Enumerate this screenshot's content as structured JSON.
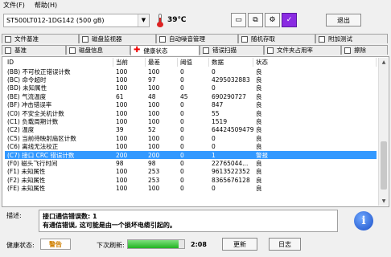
{
  "menu": {
    "file": "文件(F)",
    "help": "帮助(H)"
  },
  "toolbar": {
    "disk": "ST500LT012-1DG142 (500 gB)",
    "temperature": "39℃",
    "exit_label": "退出",
    "icons": [
      "window-icon",
      "copy-icon",
      "settings-icon",
      "check-icon"
    ]
  },
  "tabs_row1": [
    "文件基准",
    "磁盘监视器",
    "自动噪音管理",
    "随机存取",
    "附加测试"
  ],
  "tabs_row2": [
    "基准",
    "磁盘信息",
    "健康状态",
    "错误扫描",
    "文件夹占用率",
    "擦除"
  ],
  "active_tab": "健康状态",
  "table": {
    "headers": [
      "ID",
      "当前",
      "最差",
      "阈值",
      "数据",
      "状态"
    ],
    "rows": [
      [
        "(BB) 不可校正错误计数",
        "100",
        "100",
        "0",
        "0",
        "良"
      ],
      [
        "(BC) 命令超时",
        "100",
        "97",
        "0",
        "4295032883",
        "良"
      ],
      [
        "(BD) 未知属性",
        "100",
        "100",
        "0",
        "0",
        "良"
      ],
      [
        "(BE) 气流温度",
        "61",
        "48",
        "45",
        "690290727",
        "良"
      ],
      [
        "(BF) 冲击错误率",
        "100",
        "100",
        "0",
        "847",
        "良"
      ],
      [
        "(C0) 不安全关机计数",
        "100",
        "100",
        "0",
        "55",
        "良"
      ],
      [
        "(C1) 负载周期计数",
        "100",
        "100",
        "0",
        "1519",
        "良"
      ],
      [
        "(C2) 温度",
        "39",
        "52",
        "0",
        "64424509479",
        "良"
      ],
      [
        "(C5) 当前待映射扇区计数",
        "100",
        "100",
        "0",
        "0",
        "良"
      ],
      [
        "(C6) 离线无法校正",
        "100",
        "100",
        "0",
        "0",
        "良"
      ],
      [
        "(C7) 接口 CRC 错误计数",
        "200",
        "200",
        "0",
        "1",
        "警报"
      ],
      [
        "(F0) 磁头飞行时间",
        "98",
        "98",
        "0",
        "22765044...",
        "良"
      ],
      [
        "(F1) 未知属性",
        "100",
        "253",
        "0",
        "9613522352",
        "良"
      ],
      [
        "(F2) 未知属性",
        "100",
        "253",
        "0",
        "8365676128",
        "良"
      ],
      [
        "(FE) 未知属性",
        "100",
        "100",
        "0",
        "0",
        "良"
      ]
    ],
    "selected_index": 10
  },
  "description": {
    "label": "描述:",
    "line1": "接口通信错误数: 1",
    "line2": "有通信错误, 这可能是由一个损坏电缆引起的。"
  },
  "status": {
    "label": "健康状态:",
    "value": "警告",
    "value_color": "#d08000",
    "refresh_label": "下次刷新:",
    "countdown": "2:08",
    "progress_fraction": 0.9
  },
  "buttons": {
    "update": "更新",
    "log": "日志"
  }
}
